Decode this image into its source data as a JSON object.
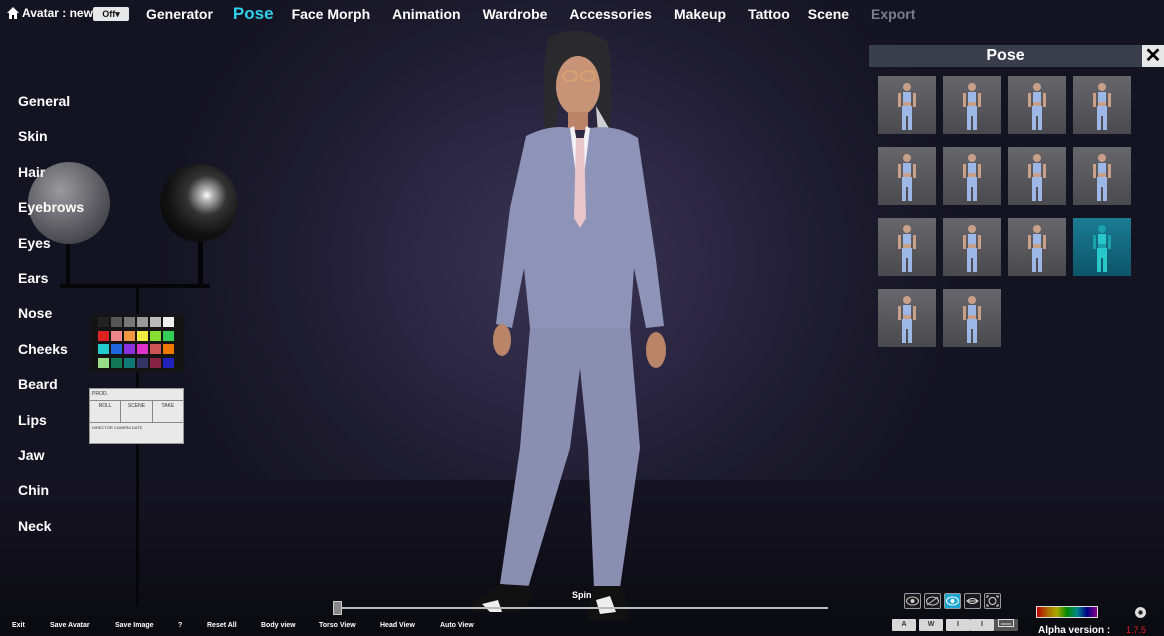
{
  "topbar": {
    "avatar_label": "Avatar : new",
    "off_button": "Off▾",
    "menu": [
      "Generator",
      "Pose",
      "Face Morph",
      "Animation",
      "Wardrobe",
      "Accessories",
      "Makeup",
      "Tattoo",
      "Scene",
      "Export"
    ],
    "active_menu": "Pose",
    "disabled_menu": "Export"
  },
  "left_list": [
    "General",
    "Skin",
    "Hair",
    "Eyebrows",
    "Eyes",
    "Ears",
    "Nose",
    "Cheeks",
    "Beard",
    "Lips",
    "Jaw",
    "Chin",
    "Neck"
  ],
  "slate": {
    "prod": "PROD.",
    "roll": "ROLL",
    "scene": "SCENE",
    "take": "TAKE",
    "fields": "DIRECTOR CAMERA DATE"
  },
  "pose_panel": {
    "title": "Pose",
    "close_icon": "close-icon",
    "selected_index": 11,
    "thumb_count": 14
  },
  "bottom": {
    "buttons": [
      "Exit",
      "Save Avatar",
      "Save Image",
      "?",
      "Reset All",
      "Body view",
      "Torso View",
      "Head View",
      "Auto View"
    ],
    "spin_label": "Spin",
    "spin_value": 0,
    "view_icons": [
      "eye-icon",
      "eye-slash-icon",
      "eye-active-icon",
      "lips-icon",
      "face-frame-icon"
    ],
    "key_buttons": [
      "A",
      "W",
      "I",
      "I"
    ],
    "alpha_label": "Alpha version :",
    "alpha_version": "1.7.5"
  },
  "colors": {
    "accent": "#2fd0ec",
    "panel_header": "#3a3e4c",
    "version_red": "#e0202a",
    "selected_thumb": "#1a7c93"
  }
}
